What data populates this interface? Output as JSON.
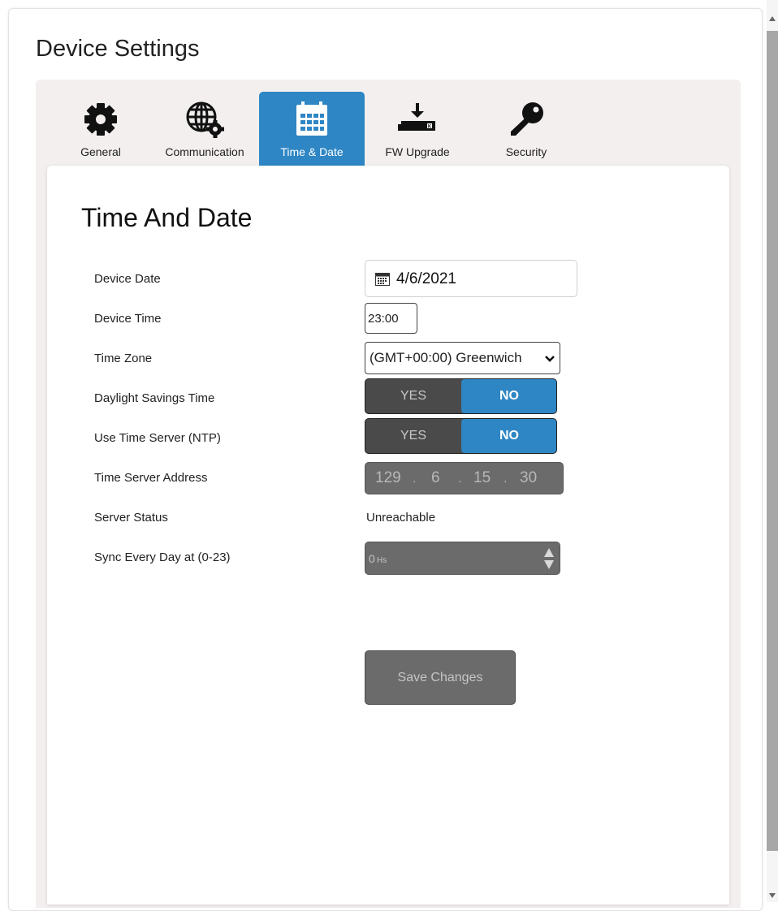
{
  "page": {
    "title": "Device Settings"
  },
  "tabs": [
    {
      "label": "General",
      "icon": "gear-icon"
    },
    {
      "label": "Communication",
      "icon": "globe-gear-icon"
    },
    {
      "label": "Time & Date",
      "icon": "calendar-icon",
      "active": true
    },
    {
      "label": "FW Upgrade",
      "icon": "firmware-download-icon"
    },
    {
      "label": "Security",
      "icon": "key-icon"
    }
  ],
  "section": {
    "title": "Time And Date"
  },
  "fields": {
    "device_date": {
      "label": "Device Date",
      "value": "4/6/2021"
    },
    "device_time": {
      "label": "Device Time",
      "value": "23:00"
    },
    "time_zone": {
      "label": "Time Zone",
      "value": "(GMT+00:00) Greenwich"
    },
    "dst": {
      "label": "Daylight Savings Time",
      "yes": "YES",
      "no": "NO",
      "selected": "NO"
    },
    "ntp": {
      "label": "Use Time Server (NTP)",
      "yes": "YES",
      "no": "NO",
      "selected": "NO"
    },
    "server_address": {
      "label": "Time Server Address",
      "octets": [
        "129",
        "6",
        "15",
        "30"
      ]
    },
    "server_status": {
      "label": "Server Status",
      "value": "Unreachable"
    },
    "sync": {
      "label": "Sync Every Day at (0-23)",
      "value": "0",
      "unit": "Hs"
    }
  },
  "actions": {
    "save_label": "Save Changes"
  },
  "colors": {
    "accent": "#2e86c4",
    "toggle_dark": "#4a4a4a",
    "disabled": "#6b6b6b"
  }
}
